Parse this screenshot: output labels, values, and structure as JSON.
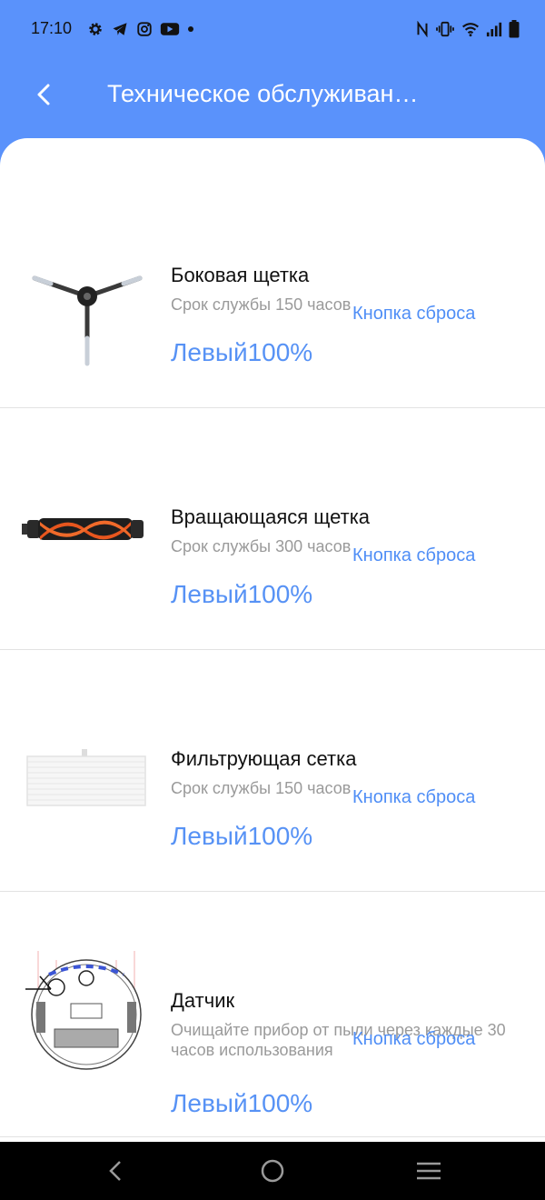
{
  "status_bar": {
    "time": "17:10",
    "left_icons": [
      "gear-icon",
      "telegram-icon",
      "instagram-icon",
      "youtube-icon",
      "dot-icon"
    ],
    "right_icons": [
      "nfc-icon",
      "vibrate-icon",
      "wifi-icon",
      "signal-icon",
      "battery-icon"
    ]
  },
  "header": {
    "title": "Техническое обслуживан…",
    "back_icon": "chevron-left-icon"
  },
  "items": [
    {
      "name": "Боковая щетка",
      "life": "Срок службы 150 часов",
      "reset": "Кнопка сброса",
      "level": "Левый100%",
      "image": "side-brush"
    },
    {
      "name": "Вращающаяся щетка",
      "life": "Срок службы 300 часов",
      "reset": "Кнопка сброса",
      "level": "Левый100%",
      "image": "main-brush"
    },
    {
      "name": "Фильтрующая сетка",
      "life": "Срок службы 150 часов",
      "reset": "Кнопка сброса",
      "level": "Левый100%",
      "image": "filter"
    },
    {
      "name": "Датчик",
      "life": "Очищайте прибор от пыли через каждые 30 часов использования",
      "reset": "Кнопка сброса",
      "level": "Левый100%",
      "image": "robot-sensor"
    }
  ],
  "nav_bar": {
    "buttons": [
      "back-icon",
      "home-icon",
      "recents-icon"
    ]
  },
  "colors": {
    "header_bg": "#5a92fb",
    "accent": "#5792f5",
    "muted_text": "#9a9a9a"
  }
}
